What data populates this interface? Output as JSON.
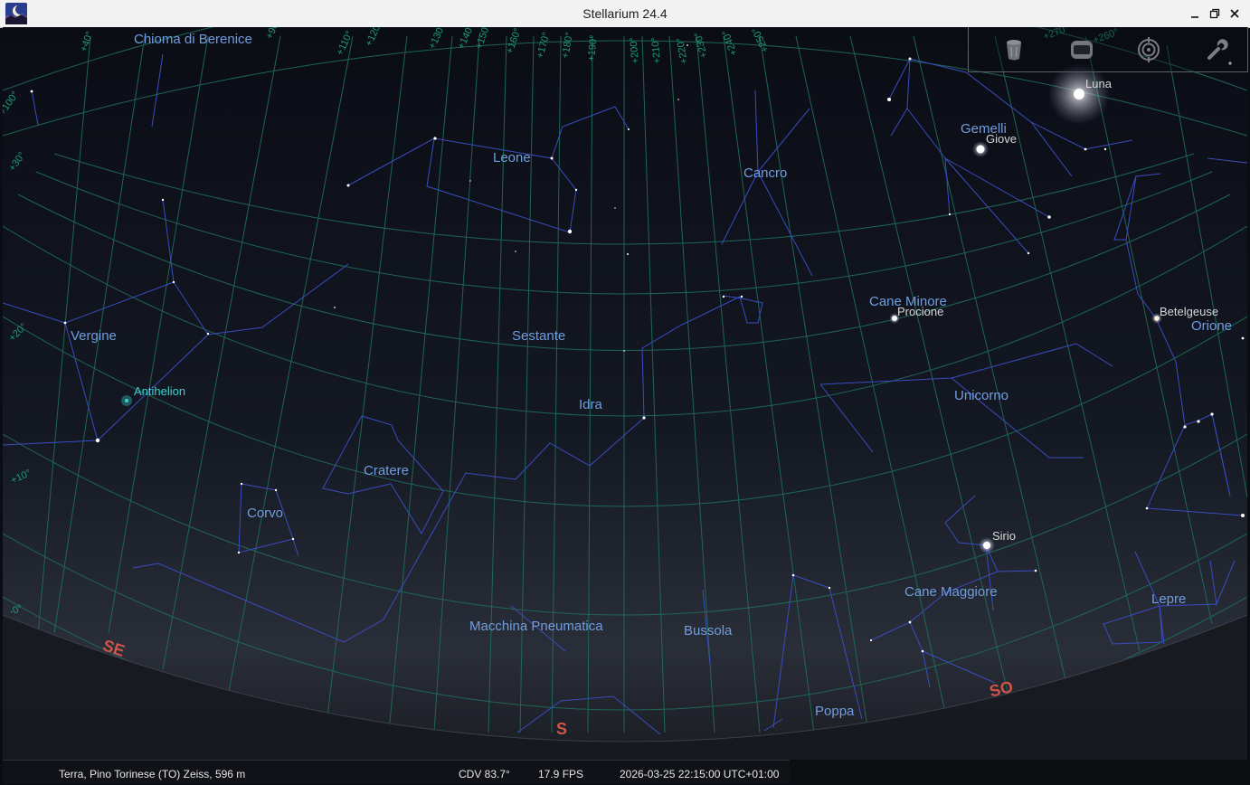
{
  "window": {
    "title": "Stellarium 24.4"
  },
  "toolbar": {
    "buttons": [
      {
        "name": "delete-icon"
      },
      {
        "name": "full-screen-icon"
      },
      {
        "name": "telescope-target-icon"
      },
      {
        "name": "wrench-icon"
      }
    ]
  },
  "constellations": [
    "Chioma di Berenice",
    "Leone",
    "Cancro",
    "Gemelli",
    "Vergine",
    "Sestante",
    "Cane Minore",
    "Orione",
    "Unicorno",
    "Idra",
    "Cratere",
    "Corvo",
    "Cane Maggiore",
    "Lepre",
    "Macchina Pneumatica",
    "Bussola",
    "Poppa"
  ],
  "objects": [
    "Luna",
    "Giove",
    "Procione",
    "Betelgeuse",
    "Sirio",
    "Antihelion"
  ],
  "compass": {
    "se": "SE",
    "s": "S",
    "so": "SO"
  },
  "grid_labels": [
    "+40°",
    "+90°",
    "+110°",
    "+120°",
    "+130°",
    "+140°",
    "+150°",
    "+160°",
    "+170°",
    "+180°",
    "+190°",
    "+200°",
    "+210°",
    "+220°",
    "+230°",
    "+240°",
    "+250°",
    "+260°",
    "+270°",
    "+100°",
    "+30°",
    "+20°",
    "+10°",
    "-0°"
  ],
  "colors": {
    "constellation_label": "#6f9de0",
    "constellation_line": "#3a4cc0",
    "grid": "#1f6e5c",
    "star_label": "#d8d8d8",
    "cardinal": "#d0544a",
    "antihelion": "#3bd3d0"
  },
  "status": {
    "location": "Terra, Pino Torinese (TO) Zeiss, 596 m",
    "fov": "CDV 83.7°",
    "fps": "17.9 FPS",
    "datetime": "2026-03-25 22:15:00 UTC+01:00"
  }
}
